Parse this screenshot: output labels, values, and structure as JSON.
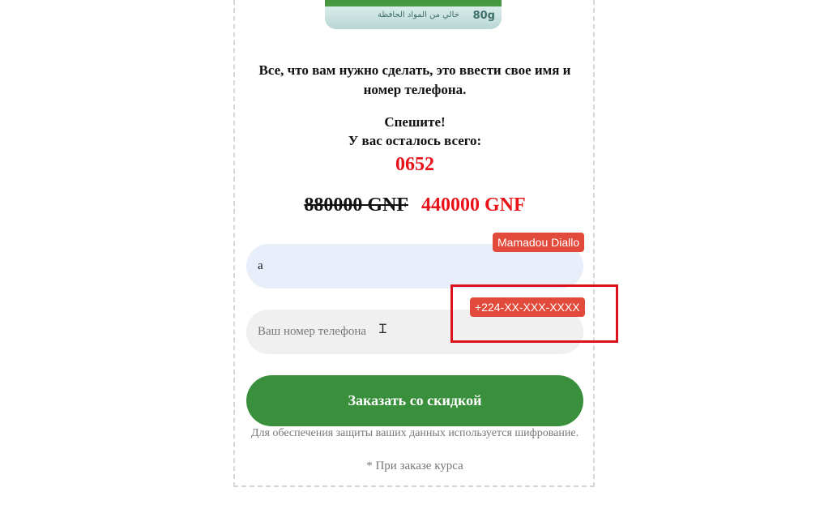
{
  "product": {
    "arabic_label": "خالي من المواد الحافظة",
    "weight": "80g"
  },
  "offer": {
    "intro": "Все, что вам нужно сделать, это ввести свое имя и номер телефона.",
    "hurry_line1": "Спешите!",
    "hurry_line2": "У вас осталось всего:",
    "counter": "0652",
    "old_price": "880000 GNF",
    "new_price": "440000 GNF"
  },
  "form": {
    "name_value": "a",
    "name_hint": "Mamadou Diallo",
    "phone_placeholder": "Ваш номер телефона",
    "phone_hint": "+224-XX-XXX-XXXX",
    "submit_label": "Заказать со скидкой",
    "privacy_note": "Для обеспечения защиты ваших данных используется шифрование.",
    "footnote": "* При заказе курса"
  },
  "colors": {
    "accent_red": "#e8131a",
    "button_green": "#3a8f3d",
    "hint_badge": "#e24a3b"
  }
}
